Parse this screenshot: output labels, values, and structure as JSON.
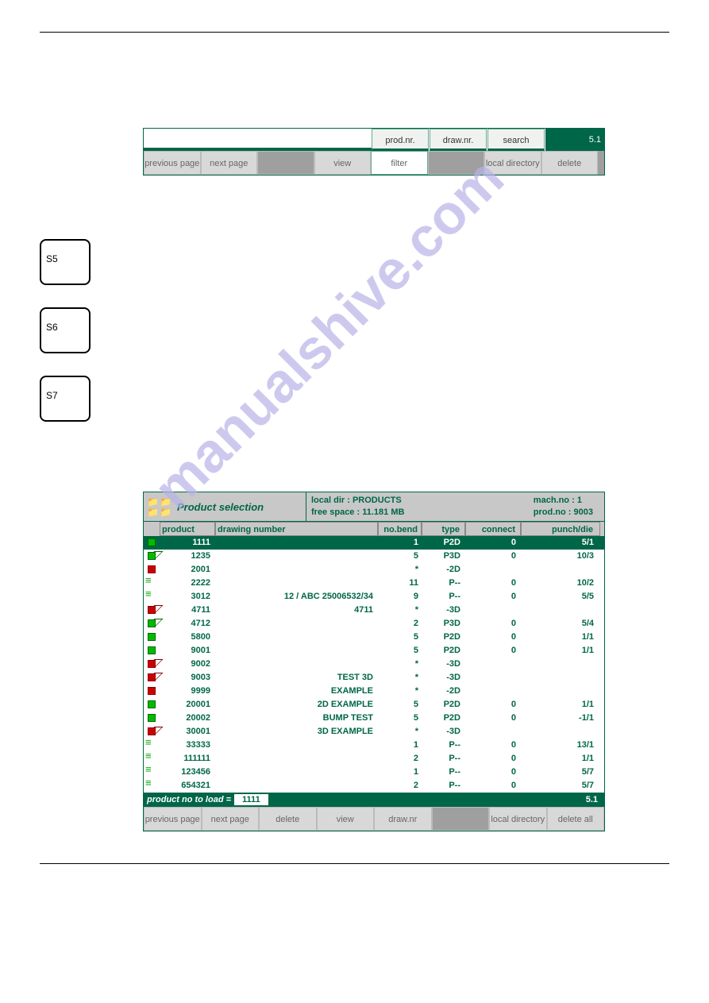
{
  "watermark": "manualshive.com",
  "panel1": {
    "top": {
      "prod": "prod.nr.",
      "draw": "draw.nr.",
      "search": "search",
      "page": "5.1"
    },
    "bottom": {
      "prevpage": "previous page",
      "nextpage": "next page",
      "view": "view",
      "filter": "filter",
      "localdir": "local directory",
      "delete": "delete"
    }
  },
  "s_buttons": {
    "s5": "S5",
    "s6": "S6",
    "s7": "S7"
  },
  "panel2": {
    "title": "Product selection",
    "info": {
      "localdir_label": "local dir :",
      "localdir_value": "PRODUCTS",
      "freespace_label": "free space :",
      "freespace_value": "11.181 MB",
      "machno_label": "mach.no :",
      "machno_value": "1",
      "prodno_label": "prod.no :",
      "prodno_value": "9003"
    },
    "columns": {
      "product": "product",
      "drawing": "drawing number",
      "nobend": "no.bend",
      "type": "type",
      "connect": "connect",
      "punchdie": "punch/die"
    },
    "rows": [
      {
        "icon": "green2d",
        "product": "1111",
        "drawing": "",
        "nobend": "1",
        "type": "P2D",
        "connect": "0",
        "punchdie": "5/1",
        "selected": true
      },
      {
        "icon": "green3d",
        "product": "1235",
        "drawing": "",
        "nobend": "5",
        "type": "P3D",
        "connect": "0",
        "punchdie": "10/3"
      },
      {
        "icon": "red2d",
        "product": "2001",
        "drawing": "",
        "nobend": "*",
        "type": "-2D",
        "connect": "",
        "punchdie": ""
      },
      {
        "icon": "lines",
        "product": "2222",
        "drawing": "",
        "nobend": "11",
        "type": "P--",
        "connect": "0",
        "punchdie": "10/2"
      },
      {
        "icon": "lines",
        "product": "3012",
        "drawing": "12 / ABC 25006532/34",
        "nobend": "9",
        "type": "P--",
        "connect": "0",
        "punchdie": "5/5"
      },
      {
        "icon": "red3d",
        "product": "4711",
        "drawing": "4711",
        "nobend": "*",
        "type": "-3D",
        "connect": "",
        "punchdie": ""
      },
      {
        "icon": "green3d",
        "product": "4712",
        "drawing": "",
        "nobend": "2",
        "type": "P3D",
        "connect": "0",
        "punchdie": "5/4"
      },
      {
        "icon": "green2d",
        "product": "5800",
        "drawing": "",
        "nobend": "5",
        "type": "P2D",
        "connect": "0",
        "punchdie": "1/1"
      },
      {
        "icon": "green2d",
        "product": "9001",
        "drawing": "",
        "nobend": "5",
        "type": "P2D",
        "connect": "0",
        "punchdie": "1/1"
      },
      {
        "icon": "red3d",
        "product": "9002",
        "drawing": "",
        "nobend": "*",
        "type": "-3D",
        "connect": "",
        "punchdie": ""
      },
      {
        "icon": "red3d",
        "product": "9003",
        "drawing": "TEST 3D",
        "nobend": "*",
        "type": "-3D",
        "connect": "",
        "punchdie": ""
      },
      {
        "icon": "red2d",
        "product": "9999",
        "drawing": "EXAMPLE",
        "nobend": "*",
        "type": "-2D",
        "connect": "",
        "punchdie": ""
      },
      {
        "icon": "green2d",
        "product": "20001",
        "drawing": "2D EXAMPLE",
        "nobend": "5",
        "type": "P2D",
        "connect": "0",
        "punchdie": "1/1"
      },
      {
        "icon": "green2d",
        "product": "20002",
        "drawing": "BUMP TEST",
        "nobend": "5",
        "type": "P2D",
        "connect": "0",
        "punchdie": "-1/1"
      },
      {
        "icon": "red3d",
        "product": "30001",
        "drawing": "3D EXAMPLE",
        "nobend": "*",
        "type": "-3D",
        "connect": "",
        "punchdie": ""
      },
      {
        "icon": "lines",
        "product": "33333",
        "drawing": "",
        "nobend": "1",
        "type": "P--",
        "connect": "0",
        "punchdie": "13/1"
      },
      {
        "icon": "lines",
        "product": "111111",
        "drawing": "",
        "nobend": "2",
        "type": "P--",
        "connect": "0",
        "punchdie": "1/1"
      },
      {
        "icon": "lines",
        "product": "123456",
        "drawing": "",
        "nobend": "1",
        "type": "P--",
        "connect": "0",
        "punchdie": "5/7"
      },
      {
        "icon": "lines",
        "product": "654321",
        "drawing": "",
        "nobend": "2",
        "type": "P--",
        "connect": "0",
        "punchdie": "5/7"
      }
    ],
    "status": {
      "label": "product no to load =",
      "value": "1111",
      "page": "5.1"
    },
    "buttons": {
      "prevpage": "previous page",
      "nextpage": "next page",
      "delete": "delete",
      "view": "view",
      "drawnr": "draw.nr",
      "localdir": "local directory",
      "deleteall": "delete all"
    }
  }
}
